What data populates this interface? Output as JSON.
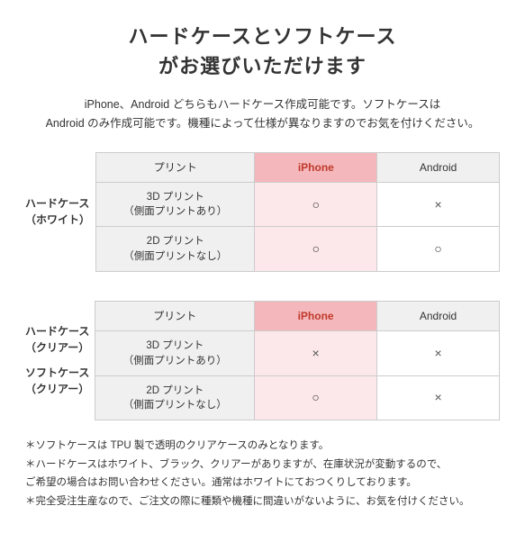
{
  "title": {
    "line1": "ハードケースとソフトケース",
    "line2": "がお選びいただけます"
  },
  "description": "iPhone、Android どちらもハードケース作成可能です。ソフトケースは\nAndroid のみ作成可能です。機種によって仕様が異なりますのでお気を付けください。",
  "table1": {
    "row_header_line1": "ハードケース",
    "row_header_line2": "（ホワイト）",
    "col_headers": [
      "プリント",
      "iPhone",
      "Android"
    ],
    "rows": [
      {
        "label_line1": "3D プリント",
        "label_line2": "（側面プリントあり）",
        "iphone": "○",
        "android": "×"
      },
      {
        "label_line1": "2D プリント",
        "label_line2": "（側面プリントなし）",
        "iphone": "○",
        "android": "○"
      }
    ]
  },
  "table2": {
    "row_header_line1": "ハードケース",
    "row_header_line2": "（クリアー）",
    "row_header2_line1": "ソフトケース",
    "row_header2_line2": "（クリアー）",
    "col_headers": [
      "プリント",
      "iPhone",
      "Android"
    ],
    "rows": [
      {
        "label_line1": "3D プリント",
        "label_line2": "（側面プリントあり）",
        "iphone": "×",
        "android": "×"
      },
      {
        "label_line1": "2D プリント",
        "label_line2": "（側面プリントなし）",
        "iphone": "○",
        "android": "×"
      }
    ]
  },
  "notes": [
    "ソフトケースは TPU 製で透明のクリアケースのみとなります。",
    "ハードケースはホワイト、ブラック、クリアーがありますが、在庫状況が変動するので、\nご希望の場合はお問い合わせください。通常はホワイトにておつくりしております。",
    "完全受注生産なので、ご注文の際に種類や機種に間違いがないように、お気を付けください。"
  ]
}
